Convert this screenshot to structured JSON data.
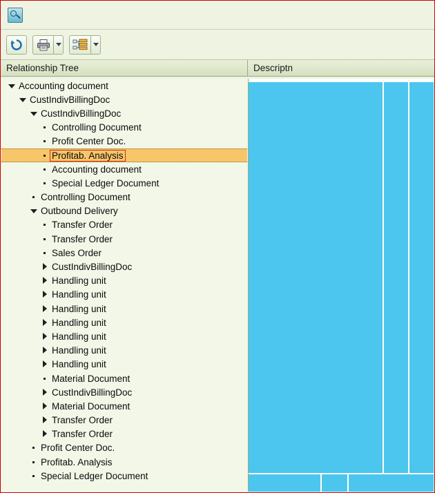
{
  "window": {
    "title_icon": "document-relationship-icon"
  },
  "toolbar": {
    "buttons": [
      {
        "name": "refresh-button",
        "icon": "refresh-icon"
      },
      {
        "name": "print-button",
        "icon": "printer-icon"
      },
      {
        "name": "print-menu-button",
        "icon": "chevron-down-icon"
      },
      {
        "name": "expand-tree-button",
        "icon": "tree-list-icon"
      },
      {
        "name": "expand-tree-menu-button",
        "icon": "chevron-down-icon"
      }
    ]
  },
  "columns": {
    "tree": "Relationship Tree",
    "description": "Descriptn"
  },
  "tree": {
    "rows": [
      {
        "label": "Accounting document",
        "indent": 0,
        "marker": "caret-down"
      },
      {
        "label": "CustIndivBillingDoc",
        "indent": 1,
        "marker": "caret-down"
      },
      {
        "label": "CustIndivBillingDoc",
        "indent": 2,
        "marker": "caret-down"
      },
      {
        "label": "Controlling Document",
        "indent": 3,
        "marker": "dot"
      },
      {
        "label": "Profit Center Doc.",
        "indent": 3,
        "marker": "dot"
      },
      {
        "label": "Profitab. Analysis",
        "indent": 3,
        "marker": "dot",
        "selected": true
      },
      {
        "label": "Accounting document",
        "indent": 3,
        "marker": "dot"
      },
      {
        "label": "Special Ledger Document",
        "indent": 3,
        "marker": "dot"
      },
      {
        "label": "Controlling Document",
        "indent": 2,
        "marker": "dot"
      },
      {
        "label": "Outbound Delivery",
        "indent": 2,
        "marker": "caret-down"
      },
      {
        "label": "Transfer Order",
        "indent": 3,
        "marker": "dot"
      },
      {
        "label": "Transfer Order",
        "indent": 3,
        "marker": "dot"
      },
      {
        "label": "Sales Order",
        "indent": 3,
        "marker": "dot"
      },
      {
        "label": "CustIndivBillingDoc",
        "indent": 3,
        "marker": "caret-right"
      },
      {
        "label": "Handling unit",
        "indent": 3,
        "marker": "caret-right"
      },
      {
        "label": "Handling unit",
        "indent": 3,
        "marker": "caret-right"
      },
      {
        "label": "Handling unit",
        "indent": 3,
        "marker": "caret-right"
      },
      {
        "label": "Handling unit",
        "indent": 3,
        "marker": "caret-right"
      },
      {
        "label": "Handling unit",
        "indent": 3,
        "marker": "caret-right"
      },
      {
        "label": "Handling unit",
        "indent": 3,
        "marker": "caret-right"
      },
      {
        "label": "Handling unit",
        "indent": 3,
        "marker": "caret-right"
      },
      {
        "label": "Material Document",
        "indent": 3,
        "marker": "dot"
      },
      {
        "label": "CustIndivBillingDoc",
        "indent": 3,
        "marker": "caret-right"
      },
      {
        "label": "Material Document",
        "indent": 3,
        "marker": "caret-right"
      },
      {
        "label": "Transfer Order",
        "indent": 3,
        "marker": "caret-right"
      },
      {
        "label": "Transfer Order",
        "indent": 3,
        "marker": "caret-right"
      },
      {
        "label": "Profit Center Doc.",
        "indent": 2,
        "marker": "dot"
      },
      {
        "label": "Profitab. Analysis",
        "indent": 2,
        "marker": "dot"
      },
      {
        "label": "Special Ledger Document",
        "indent": 2,
        "marker": "dot"
      }
    ]
  },
  "colors": {
    "selection_fill": "#f7c66a",
    "selection_border": "#cf2f22",
    "panel_bg": "#eef3e2",
    "tree_bg": "#f2f7e8",
    "description_block": "#4cc6ee",
    "window_border": "#cc0000"
  }
}
